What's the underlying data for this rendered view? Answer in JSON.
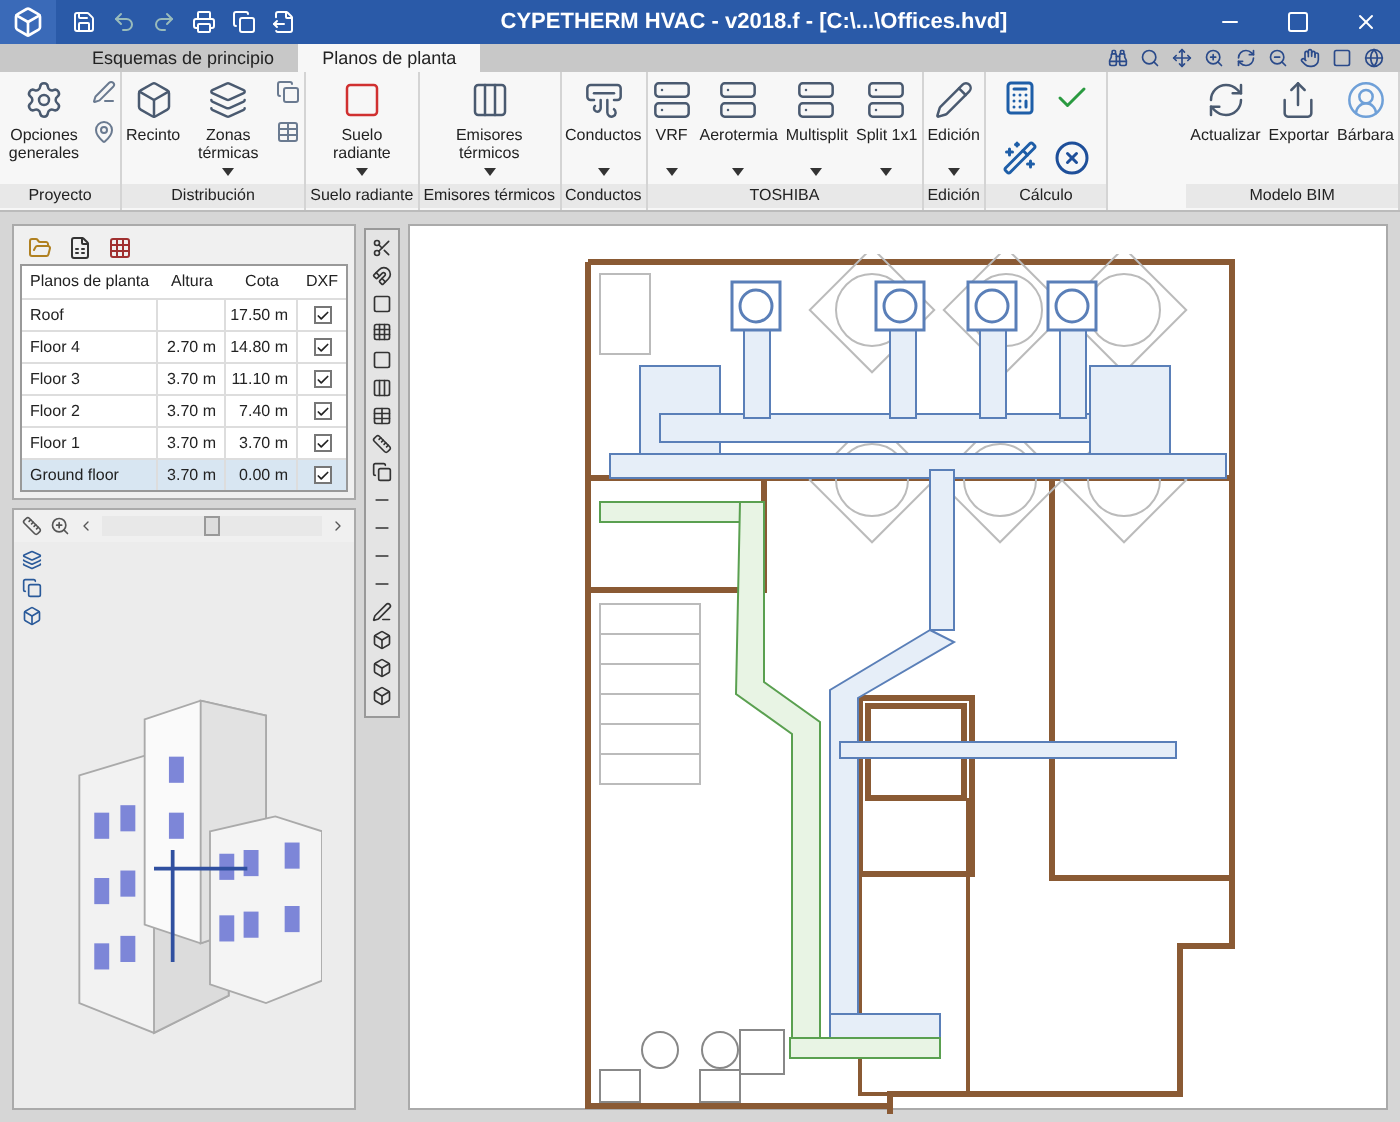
{
  "window": {
    "title": "CYPETHERM HVAC - v2018.f - [C:\\...\\Offices.hvd]"
  },
  "tabs": [
    {
      "label": "Esquemas de principio",
      "selected": false
    },
    {
      "label": "Planos de planta",
      "selected": true
    }
  ],
  "ribbon": [
    {
      "label": "Proyecto",
      "buttons": [
        {
          "kind": "big",
          "label": "Opciones generales",
          "dropdown": false
        },
        {
          "kind": "smallstack"
        }
      ]
    },
    {
      "label": "Distribución",
      "buttons": [
        {
          "kind": "big",
          "label": "Recinto",
          "dropdown": false
        },
        {
          "kind": "big",
          "label": "Zonas térmicas",
          "dropdown": true
        },
        {
          "kind": "smallstack"
        }
      ]
    },
    {
      "label": "Suelo radiante",
      "buttons": [
        {
          "kind": "big",
          "label": "Suelo radiante",
          "dropdown": true
        }
      ]
    },
    {
      "label": "Emisores térmicos",
      "buttons": [
        {
          "kind": "big",
          "label": "Emisores térmicos",
          "dropdown": true
        }
      ]
    },
    {
      "label": "Conductos",
      "buttons": [
        {
          "kind": "big",
          "label": "Conductos",
          "dropdown": true
        }
      ]
    },
    {
      "label": "TOSHIBA",
      "buttons": [
        {
          "kind": "big",
          "label": "VRF",
          "dropdown": true
        },
        {
          "kind": "big",
          "label": "Aerotermia",
          "dropdown": true
        },
        {
          "kind": "big",
          "label": "Multisplit",
          "dropdown": true
        },
        {
          "kind": "big",
          "label": "Split 1x1",
          "dropdown": true
        }
      ]
    },
    {
      "label": "Edición",
      "buttons": [
        {
          "kind": "big",
          "label": "Edición",
          "dropdown": true
        }
      ]
    },
    {
      "label": "Cálculo",
      "buttons": [
        {
          "kind": "smallgrid"
        }
      ]
    },
    {
      "label": "Modelo BIM",
      "buttons": [
        {
          "kind": "big",
          "label": "Actualizar",
          "dropdown": false
        },
        {
          "kind": "big",
          "label": "Exportar",
          "dropdown": false
        },
        {
          "kind": "big",
          "label": "Bárbara",
          "dropdown": false
        }
      ]
    }
  ],
  "floors_table": {
    "columns": [
      "Planos de planta",
      "Altura",
      "Cota",
      "DXF"
    ],
    "rows": [
      {
        "name": "Roof",
        "height": "",
        "level": "17.50 m",
        "dxf": true,
        "selected": false
      },
      {
        "name": "Floor 4",
        "height": "2.70 m",
        "level": "14.80 m",
        "dxf": true,
        "selected": false
      },
      {
        "name": "Floor 3",
        "height": "3.70 m",
        "level": "11.10 m",
        "dxf": true,
        "selected": false
      },
      {
        "name": "Floor 2",
        "height": "3.70 m",
        "level": "7.40 m",
        "dxf": true,
        "selected": false
      },
      {
        "name": "Floor 1",
        "height": "3.70 m",
        "level": "3.70 m",
        "dxf": true,
        "selected": false
      },
      {
        "name": "Ground floor",
        "height": "3.70 m",
        "level": "0.00 m",
        "dxf": true,
        "selected": true
      }
    ]
  },
  "view3d": {
    "zoom_slider": {
      "level": 0.5
    }
  }
}
